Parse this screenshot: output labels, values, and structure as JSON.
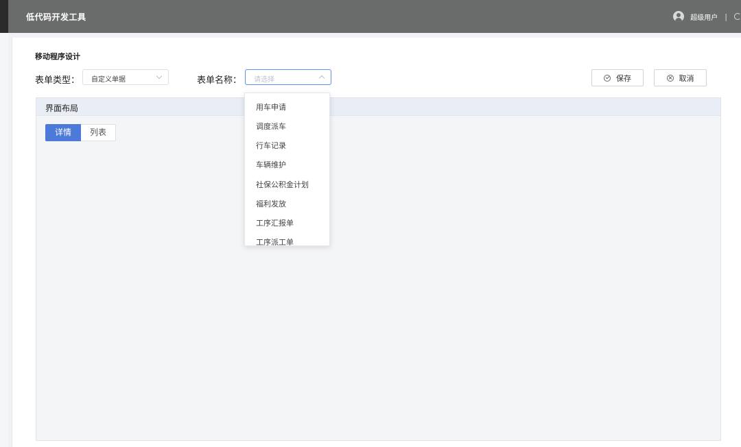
{
  "header": {
    "app_title": "低代码开发工具",
    "user_name": "超级用户",
    "separator": "|"
  },
  "page": {
    "title": "移动程序设计",
    "form_type_label": "表单类型：",
    "form_type_value": "自定义单据",
    "form_name_label": "表单名称：",
    "form_name_placeholder": "请选择",
    "save_label": "保存",
    "cancel_label": "取消"
  },
  "layout": {
    "title": "界面布局",
    "tabs": [
      {
        "label": "详情",
        "active": true
      },
      {
        "label": "列表",
        "active": false
      }
    ]
  },
  "dropdown": {
    "options": [
      "用车申请",
      "调度派车",
      "行车记录",
      "车辆维护",
      "社保公积金计划",
      "福利发放",
      "工序汇报单",
      "工序派工单"
    ]
  },
  "colors": {
    "topbar": "#6a6b6b",
    "accent": "#4d7ad8",
    "focus_border": "#5b8def"
  }
}
